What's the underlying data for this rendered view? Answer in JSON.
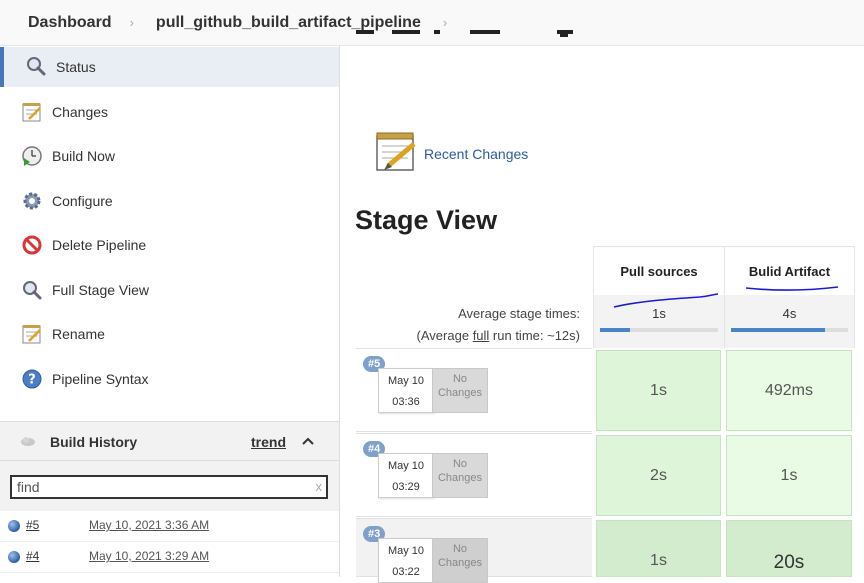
{
  "breadcrumb": {
    "items": [
      "Dashboard",
      "pull_github_build_artifact_pipeline"
    ]
  },
  "sidebar": {
    "tasks": [
      {
        "label": "Status",
        "icon": "search-icon",
        "active": true
      },
      {
        "label": "Changes",
        "icon": "notepad-icon"
      },
      {
        "label": "Build Now",
        "icon": "clock-play-icon"
      },
      {
        "label": "Configure",
        "icon": "gear-icon"
      },
      {
        "label": "Delete Pipeline",
        "icon": "no-entry-icon"
      },
      {
        "label": "Full Stage View",
        "icon": "search-icon"
      },
      {
        "label": "Rename",
        "icon": "notepad-icon"
      },
      {
        "label": "Pipeline Syntax",
        "icon": "help-icon"
      }
    ]
  },
  "build_history": {
    "title": "Build History",
    "trend": "trend",
    "find_value": "find",
    "builds": [
      {
        "number": "#5",
        "date": "May 10, 2021 3:36 AM"
      },
      {
        "number": "#4",
        "date": "May 10, 2021 3:29 AM"
      }
    ]
  },
  "main": {
    "recent_changes": "Recent Changes",
    "stage_view_title": "Stage View",
    "stages": [
      "Pull sources",
      "Bulid Artifact"
    ],
    "avg_label": "Average stage times:",
    "avg_full_pre": "(Average ",
    "avg_full_link": "full",
    "avg_full_post": " run time: ~12s)",
    "avg_times": [
      "1s",
      "4s"
    ],
    "avg_fill": [
      0.25,
      0.8
    ],
    "runs": [
      {
        "badge": "#5",
        "date": "May 10",
        "time": "03:36",
        "no_changes": [
          "No",
          "Changes"
        ],
        "times": [
          "1s",
          "492ms"
        ]
      },
      {
        "badge": "#4",
        "date": "May 10",
        "time": "03:29",
        "no_changes": [
          "No",
          "Changes"
        ],
        "times": [
          "2s",
          "1s"
        ]
      },
      {
        "badge": "#3",
        "date": "May 10",
        "time": "03:22",
        "no_changes": [
          "No",
          "Changes"
        ],
        "times": [
          "1s",
          "20s"
        ]
      }
    ]
  },
  "colors": {
    "accent": "#4b75b9",
    "link": "#2b5aa5",
    "stage_success": "#dff5d9",
    "annotation": "#1b1bd6"
  }
}
